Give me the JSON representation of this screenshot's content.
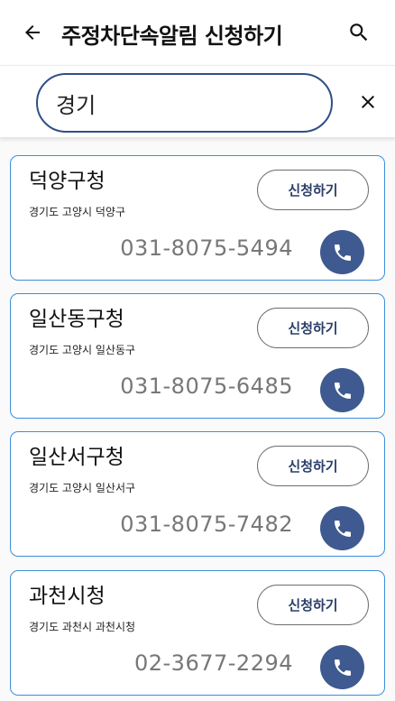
{
  "header": {
    "title": "주정차단속알림 신청하기",
    "back_icon": "arrow-left-icon",
    "search_icon": "search-icon"
  },
  "search": {
    "value": "경기",
    "clear_icon": "close-icon",
    "border_color": "#2f4f86"
  },
  "offices": [
    {
      "name": "덕양구청",
      "address": "경기도 고양시 덕양구",
      "phone": "031-8075-5494",
      "apply_label": "신청하기"
    },
    {
      "name": "일산동구청",
      "address": "경기도 고양시 일산동구",
      "phone": "031-8075-6485",
      "apply_label": "신청하기"
    },
    {
      "name": "일산서구청",
      "address": "경기도 고양시 일산서구",
      "phone": "031-8075-7482",
      "apply_label": "신청하기"
    },
    {
      "name": "과천시청",
      "address": "경기도 과천시 과천시청",
      "phone": "02-3677-2294",
      "apply_label": "신청하기"
    }
  ],
  "colors": {
    "card_border": "#3b8fdb",
    "call_button": "#3e5a90",
    "apply_text": "#2a3f6a"
  }
}
